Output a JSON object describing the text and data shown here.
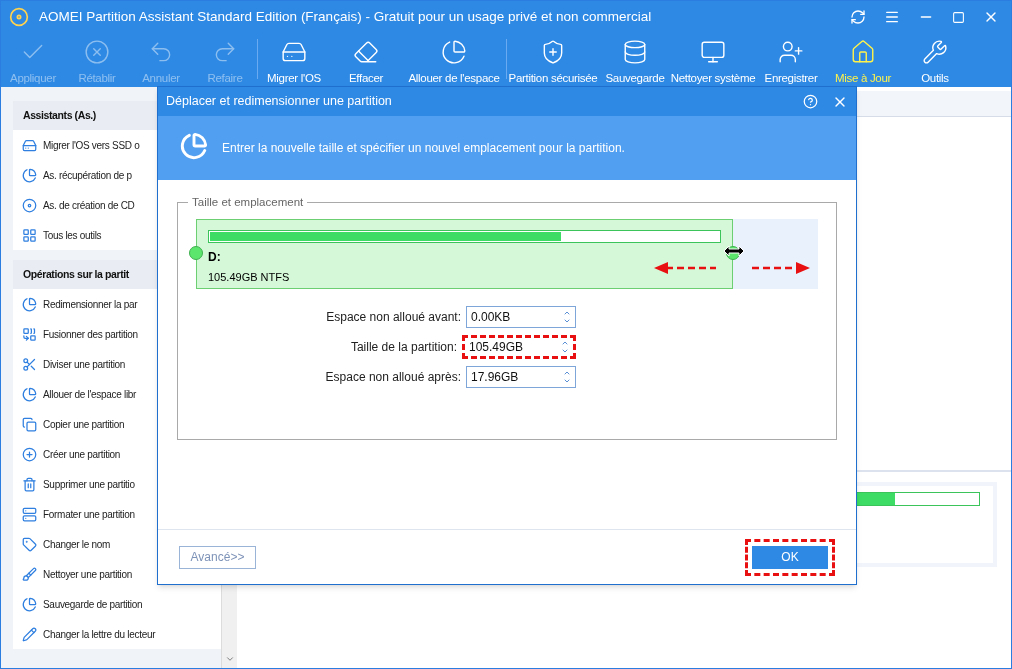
{
  "window": {
    "title": "AOMEI Partition Assistant Standard Edition (Français) - Gratuit pour un usage privé et non commercial"
  },
  "toolbar": [
    {
      "label": "Appliquer",
      "disabled": true,
      "highlighted": false
    },
    {
      "label": "Rétablir",
      "disabled": true,
      "highlighted": false
    },
    {
      "label": "Annuler",
      "disabled": true,
      "highlighted": false
    },
    {
      "label": "Refaire",
      "disabled": true,
      "highlighted": false
    },
    {
      "label": "Migrer l'OS",
      "disabled": false,
      "highlighted": false
    },
    {
      "label": "Effacer",
      "disabled": false,
      "highlighted": false
    },
    {
      "label": "Allouer de l'espace",
      "disabled": false,
      "highlighted": false
    },
    {
      "label": "Partition sécurisée",
      "disabled": false,
      "highlighted": false
    },
    {
      "label": "Sauvegarde",
      "disabled": false,
      "highlighted": false
    },
    {
      "label": "Nettoyer système",
      "disabled": false,
      "highlighted": false
    },
    {
      "label": "Enregistrer",
      "disabled": false,
      "highlighted": false
    },
    {
      "label": "Mise à Jour",
      "disabled": false,
      "highlighted": true
    },
    {
      "label": "Outils",
      "disabled": false,
      "highlighted": false
    }
  ],
  "sidebar": [
    {
      "title": "Assistants (As.)",
      "items": [
        "Migrer l'OS vers SSD o",
        "As. récupération de p",
        "As. de création de CD",
        "Tous les outils"
      ]
    },
    {
      "title": "Opérations sur la partit",
      "items": [
        "Redimensionner la par",
        "Fusionner des partition",
        "Diviser une partition",
        "Allouer de l'espace libr",
        "Copier une partition",
        "Créer une partition",
        "Supprimer une partitio",
        "Formater une partition",
        "Changer le nom",
        "Nettoyer une partition",
        "Sauvegarde de partition",
        "Changer la lettre du lecteur"
      ]
    }
  ],
  "disk_bar": {
    "level": 0.36
  },
  "dialog": {
    "title": "Déplacer et redimensionner une partition",
    "instruction": "Entrer la nouvelle taille et spécifier un nouvel emplacement pour la partition.",
    "group_title": "Taille et emplacement",
    "partition": {
      "letter": "D:",
      "detail": "105.49GB NTFS",
      "level": 0.69
    },
    "fields": [
      {
        "label": "Espace non alloué avant:",
        "value": "0.00KB",
        "highlighted": false
      },
      {
        "label": "Taille de la partition:",
        "value": "105.49GB",
        "highlighted": true
      },
      {
        "label": "Espace non alloué après:",
        "value": "17.96GB",
        "highlighted": false
      }
    ],
    "advanced_button": "Avancé>>",
    "ok_button": {
      "label": "OK",
      "highlighted": true
    }
  }
}
